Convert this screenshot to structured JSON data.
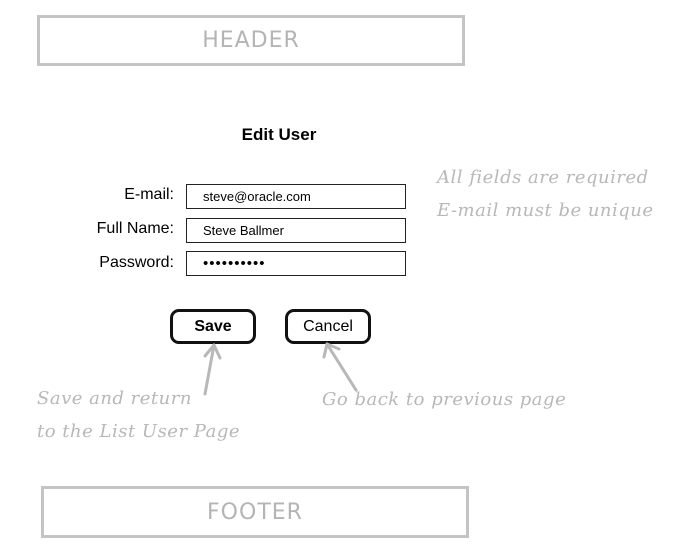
{
  "header": {
    "label": "HEADER"
  },
  "form": {
    "title": "Edit User",
    "fields": {
      "email": {
        "label": "E-mail:",
        "value": "steve@oracle.com"
      },
      "full_name": {
        "label": "Full Name:",
        "value": "Steve Ballmer"
      },
      "password": {
        "label": "Password:",
        "value": "••••••••••"
      }
    },
    "buttons": {
      "save": "Save",
      "cancel": "Cancel"
    }
  },
  "annotations": {
    "rules_line1": "All fields are required",
    "rules_line2": "E-mail must be unique",
    "save_line1": "Save and return",
    "save_line2": "to the List User Page",
    "cancel": "Go back to previous page"
  },
  "footer": {
    "label": "FOOTER"
  },
  "colors": {
    "box_border": "#c4c4c4",
    "annotation": "#b8b8b8",
    "button_border": "#111111"
  }
}
